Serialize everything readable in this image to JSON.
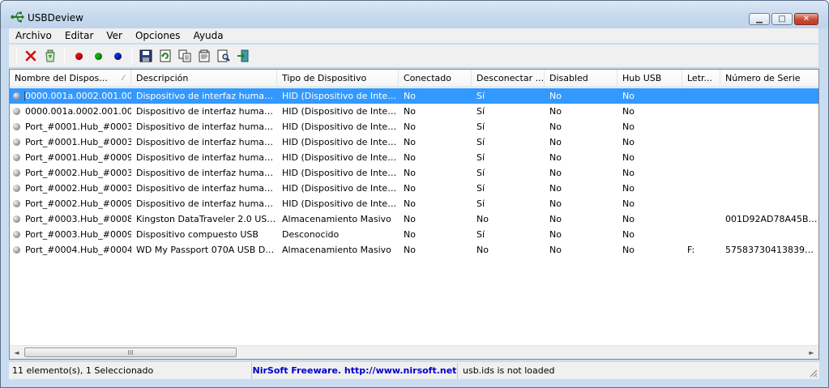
{
  "window": {
    "title": "USBDeview"
  },
  "colors": {
    "selection": "#3399ff",
    "link": "#0000cc",
    "red_dot": "#e01010",
    "green_dot": "#10b010",
    "blue_dot": "#1030d0"
  },
  "menu": [
    "Archivo",
    "Editar",
    "Ver",
    "Opciones",
    "Ayuda"
  ],
  "toolbar": [
    "delete-icon",
    "recycle-icon",
    "red-dot-icon",
    "green-dot-icon",
    "blue-dot-icon",
    "save-icon",
    "refresh-icon",
    "copy-icon",
    "properties-icon",
    "find-icon",
    "exit-icon"
  ],
  "columns": [
    "Nombre del Dispos...",
    "Descripción",
    "Tipo de Dispositivo",
    "Conectado",
    "Desconectar ...",
    "Disabled",
    "Hub USB",
    "Letr...",
    "Número de Serie"
  ],
  "sort_indicator": "⁄",
  "rows": [
    [
      "0000.001a.0002.001.00...",
      "Dispositivo de interfaz human...",
      "HID (Dispositivo de Inter...",
      "No",
      "Sí",
      "No",
      "No",
      "",
      ""
    ],
    [
      "0000.001a.0002.001.00...",
      "Dispositivo de interfaz human...",
      "HID (Dispositivo de Inter...",
      "No",
      "Sí",
      "No",
      "No",
      "",
      ""
    ],
    [
      "Port_#0001.Hub_#0003",
      "Dispositivo de interfaz human...",
      "HID (Dispositivo de Inter...",
      "No",
      "Sí",
      "No",
      "No",
      "",
      ""
    ],
    [
      "Port_#0001.Hub_#0003",
      "Dispositivo de interfaz human...",
      "HID (Dispositivo de Inter...",
      "No",
      "Sí",
      "No",
      "No",
      "",
      ""
    ],
    [
      "Port_#0001.Hub_#0009",
      "Dispositivo de interfaz human...",
      "HID (Dispositivo de Inter...",
      "No",
      "Sí",
      "No",
      "No",
      "",
      ""
    ],
    [
      "Port_#0002.Hub_#0003",
      "Dispositivo de interfaz human...",
      "HID (Dispositivo de Inter...",
      "No",
      "Sí",
      "No",
      "No",
      "",
      ""
    ],
    [
      "Port_#0002.Hub_#0003",
      "Dispositivo de interfaz human...",
      "HID (Dispositivo de Inter...",
      "No",
      "Sí",
      "No",
      "No",
      "",
      ""
    ],
    [
      "Port_#0002.Hub_#0009",
      "Dispositivo de interfaz human...",
      "HID (Dispositivo de Inter...",
      "No",
      "Sí",
      "No",
      "No",
      "",
      ""
    ],
    [
      "Port_#0003.Hub_#0008",
      "Kingston DataTraveler 2.0 USB...",
      "Almacenamiento Masivo",
      "No",
      "No",
      "No",
      "No",
      "",
      "001D92AD78A45B8..."
    ],
    [
      "Port_#0003.Hub_#0009",
      "Dispositivo compuesto USB",
      "Desconocido",
      "No",
      "Sí",
      "No",
      "No",
      "",
      ""
    ],
    [
      "Port_#0004.Hub_#0004",
      "WD My Passport 070A USB De...",
      "Almacenamiento Masivo",
      "No",
      "No",
      "No",
      "No",
      "F:",
      "5758373041383958..."
    ]
  ],
  "selected_row": 0,
  "scroll": {
    "thumb_grip": "III",
    "left": "◄",
    "right": "►"
  },
  "status": {
    "count": "11 elemento(s), 1 Seleccionado",
    "nirsoft": "NirSoft Freeware.  http://www.nirsoft.net",
    "usbids": "usb.ids is not loaded"
  },
  "window_buttons": {
    "minimize": "▁",
    "maximize": "□",
    "close": "✕"
  }
}
